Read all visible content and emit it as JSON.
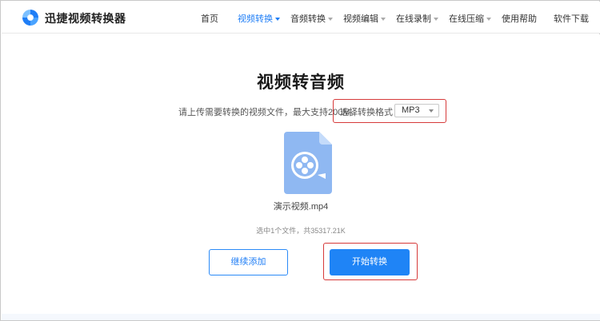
{
  "header": {
    "brand": "迅捷视频转换器",
    "nav": [
      {
        "label": "首页",
        "has_caret": false,
        "active": false
      },
      {
        "label": "视频转换",
        "has_caret": true,
        "active": true
      },
      {
        "label": "音频转换",
        "has_caret": true,
        "active": false
      },
      {
        "label": "视频编辑",
        "has_caret": true,
        "active": false
      },
      {
        "label": "在线录制",
        "has_caret": true,
        "active": false
      },
      {
        "label": "在线压缩",
        "has_caret": true,
        "active": false
      },
      {
        "label": "使用帮助",
        "has_caret": false,
        "active": false
      },
      {
        "label": "软件下载",
        "has_caret": false,
        "active": false
      }
    ]
  },
  "main": {
    "title": "视频转音频",
    "hint": "请上传需要转换的视频文件，最大支持200M。",
    "format_label": "选择转换格式：",
    "format_value": "MP3",
    "file_name": "演示视频.mp4",
    "file_count": "选中1个文件，共35317.21K",
    "continue_label": "继续添加",
    "start_label": "开始转换"
  },
  "colors": {
    "accent": "#1f7ef6",
    "button_primary": "#1f84f6",
    "highlight": "#d63a3a",
    "file_icon": "#8fb8f2"
  },
  "icons": {
    "logo": "app-logo-icon",
    "file": "video-file-icon",
    "dropdown": "chevron-down-icon"
  }
}
